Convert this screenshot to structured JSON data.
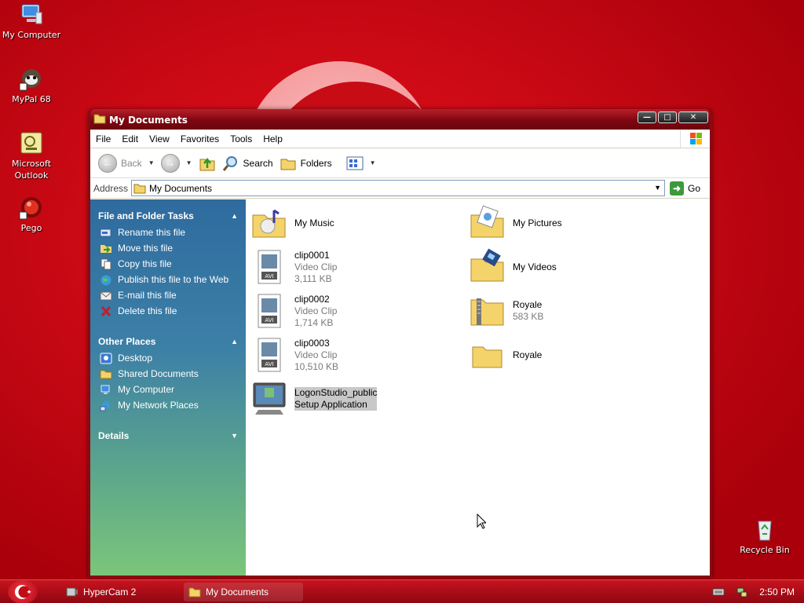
{
  "desktop": {
    "icons": [
      {
        "label": "My Computer",
        "icon": "my-computer-icon"
      },
      {
        "label": "MyPal 68",
        "icon": "mypal-icon"
      },
      {
        "label": "Microsoft Outlook",
        "icon": "outlook-icon"
      },
      {
        "label": "Pego",
        "icon": "pego-icon"
      },
      {
        "label": "Recycle Bin",
        "icon": "recycle-bin-icon"
      }
    ]
  },
  "window": {
    "title": "My Documents",
    "title_icon": "folder-icon"
  },
  "menubar": {
    "items": [
      "File",
      "Edit",
      "View",
      "Favorites",
      "Tools",
      "Help"
    ]
  },
  "toolbar": {
    "back_label": "Back",
    "search_label": "Search",
    "folders_label": "Folders"
  },
  "address": {
    "label": "Address",
    "value": "My Documents",
    "go_label": "Go"
  },
  "taskpane": {
    "file_tasks": {
      "title": "File and Folder Tasks",
      "items": [
        "Rename this file",
        "Move this file",
        "Copy this file",
        "Publish this file to the Web",
        "E-mail this file",
        "Delete this file"
      ]
    },
    "other_places": {
      "title": "Other Places",
      "items": [
        "Desktop",
        "Shared Documents",
        "My Computer",
        "My Network Places"
      ]
    },
    "details": {
      "title": "Details"
    }
  },
  "files": [
    {
      "name": "My Music",
      "type": "",
      "size": "",
      "icon": "music-folder-icon"
    },
    {
      "name": "My Pictures",
      "type": "",
      "size": "",
      "icon": "pictures-folder-icon"
    },
    {
      "name": "clip0001",
      "type": "Video Clip",
      "size": "3,111 KB",
      "icon": "avi-file-icon"
    },
    {
      "name": "My Videos",
      "type": "",
      "size": "",
      "icon": "videos-folder-icon"
    },
    {
      "name": "clip0002",
      "type": "Video Clip",
      "size": "1,714 KB",
      "icon": "avi-file-icon"
    },
    {
      "name": "Royale",
      "type": "",
      "size": "583 KB",
      "icon": "zip-folder-icon"
    },
    {
      "name": "clip0003",
      "type": "Video Clip",
      "size": "10,510 KB",
      "icon": "avi-file-icon"
    },
    {
      "name": "Royale",
      "type": "",
      "size": "",
      "icon": "folder-icon"
    },
    {
      "name": "LogonStudio_public",
      "type": "Setup Application",
      "size": "",
      "icon": "setup-app-icon"
    }
  ],
  "taskbar": {
    "tasks": [
      {
        "label": "HyperCam 2",
        "active": false
      },
      {
        "label": "My Documents",
        "active": true
      }
    ],
    "clock": "2:50 PM"
  },
  "colors": {
    "desktop": "#cc0a15",
    "titlebar": "#7e0610",
    "taskpane_top": "#2e6b9f",
    "taskpane_bottom": "#7bc67a"
  }
}
